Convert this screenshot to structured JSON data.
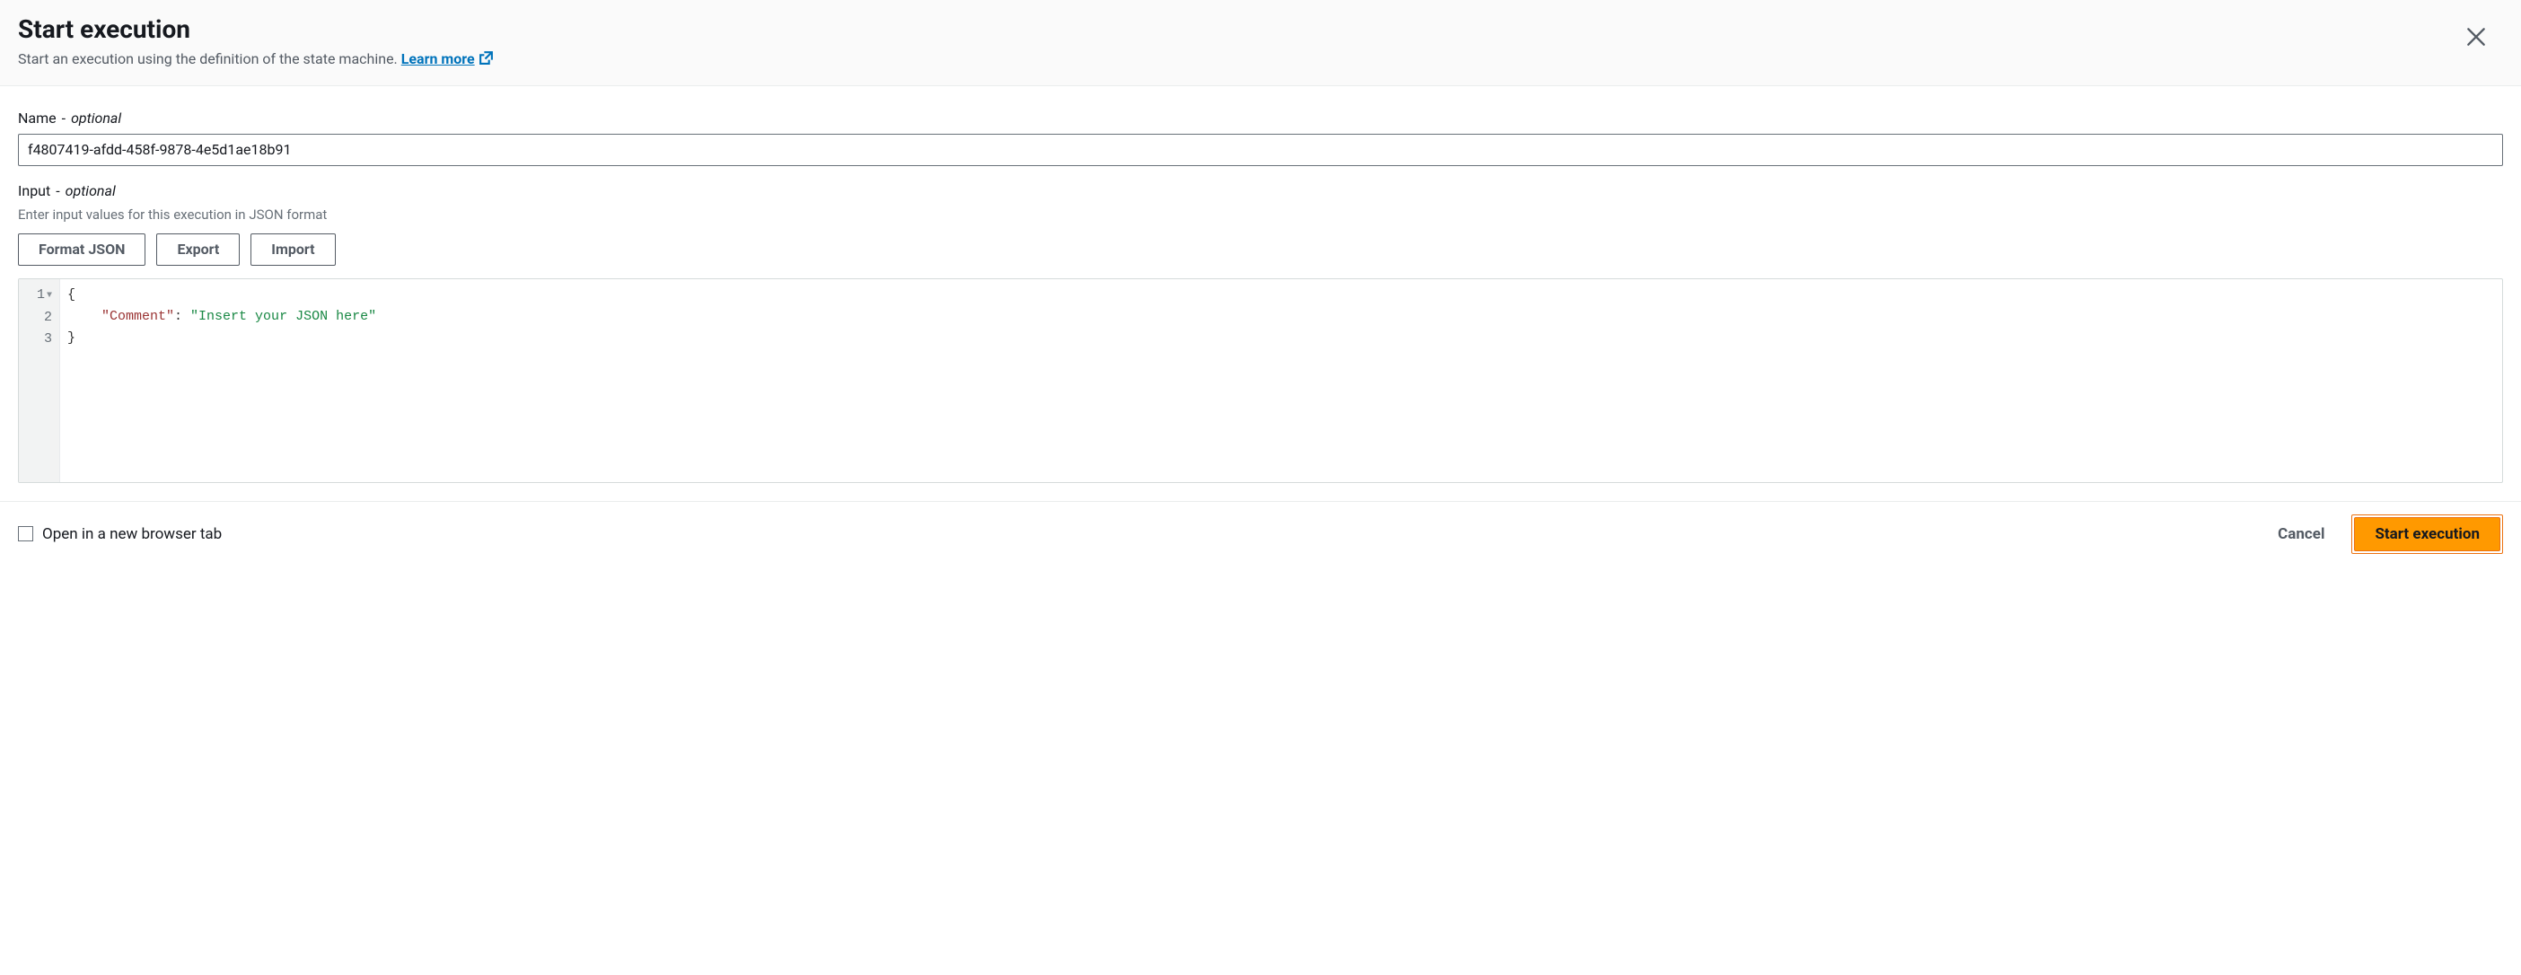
{
  "header": {
    "title": "Start execution",
    "subtitle": "Start an execution using the definition of the state machine.",
    "learn_more": "Learn more"
  },
  "name_section": {
    "label": "Name",
    "dash": "-",
    "optional": "optional",
    "value": "f4807419-afdd-458f-9878-4e5d1ae18b91"
  },
  "input_section": {
    "label": "Input",
    "dash": "-",
    "optional": "optional",
    "helper": "Enter input values for this execution in JSON format",
    "format_btn": "Format JSON",
    "export_btn": "Export",
    "import_btn": "Import"
  },
  "editor": {
    "gutter": {
      "l1": "1",
      "l2": "2",
      "l3": "3"
    },
    "line1_brace": "{",
    "line2_key": "\"Comment\"",
    "line2_colon": ":",
    "line2_str": "\"Insert your JSON here\"",
    "line3_brace": "}"
  },
  "footer": {
    "open_new_tab": "Open in a new browser tab",
    "cancel": "Cancel",
    "start": "Start execution"
  }
}
